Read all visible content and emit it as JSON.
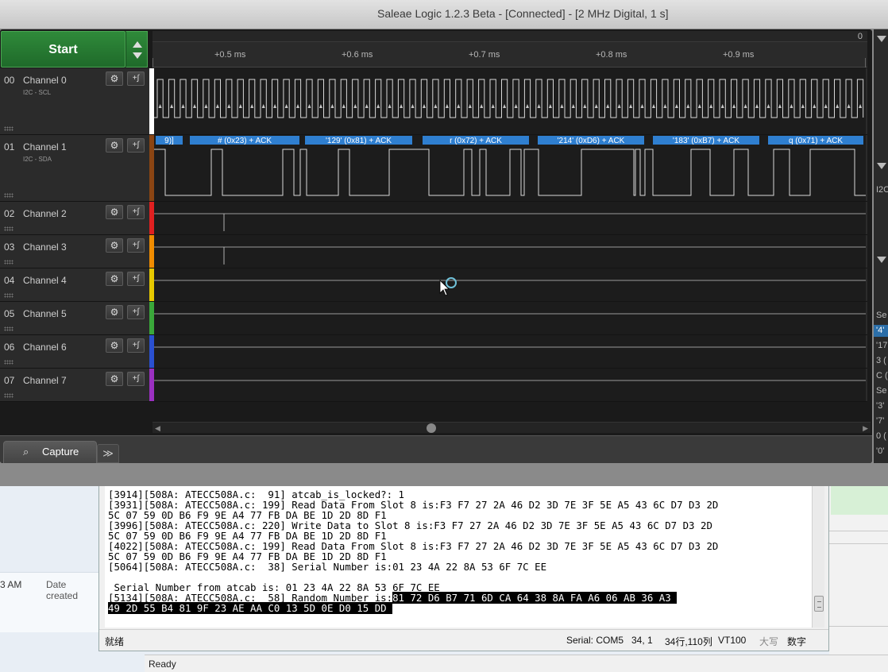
{
  "window": {
    "title": "Saleae Logic 1.2.3 Beta - [Connected] - [2 MHz Digital, 1 s]"
  },
  "toolbar": {
    "start_label": "Start"
  },
  "timeline": {
    "ticks": [
      "+0.5 ms",
      "+0.6 ms",
      "+0.7 ms",
      "+0.8 ms",
      "+0.9 ms"
    ],
    "corner_label": "0"
  },
  "channels": [
    {
      "num": "00",
      "name": "Channel 0",
      "sub": "I2C - SCL",
      "color": "#ffffff"
    },
    {
      "num": "01",
      "name": "Channel 1",
      "sub": "I2C - SDA",
      "color": "#8b4513"
    },
    {
      "num": "02",
      "name": "Channel 2",
      "sub": "",
      "color": "#e02020"
    },
    {
      "num": "03",
      "name": "Channel 3",
      "sub": "",
      "color": "#f08c00"
    },
    {
      "num": "04",
      "name": "Channel 4",
      "sub": "",
      "color": "#e6c800"
    },
    {
      "num": "05",
      "name": "Channel 5",
      "sub": "",
      "color": "#3aa83a"
    },
    {
      "num": "06",
      "name": "Channel 6",
      "sub": "",
      "color": "#2a50d0"
    },
    {
      "num": "07",
      "name": "Channel 7",
      "sub": "",
      "color": "#9a30c0"
    }
  ],
  "decoder_labels": [
    "9)]",
    "# (0x23) + ACK",
    "'129' (0x81) + ACK",
    "r (0x72) + ACK",
    "'214' (0xD6) + ACK",
    "'183' (0xB7) + ACK",
    "q (0x71) + ACK"
  ],
  "tabs": {
    "capture_label": "Capture",
    "more_label": "≫"
  },
  "right_panel": {
    "items": [
      "I2C",
      "Se",
      "'4'",
      "'17",
      "3 (",
      "C (",
      "Se",
      "'3'",
      "'7'",
      "0 (",
      "'0'"
    ]
  },
  "terminal": {
    "lines": [
      {
        "text": "[3914][508A: ATECC508A.c:  91] atcab_is_locked?: 1"
      },
      {
        "text": "[3931][508A: ATECC508A.c: 199] Read Data From Slot 8 is:F3 F7 27 2A 46 D2 3D 7E 3F 5E A5 43 6C D7 D3 2D"
      },
      {
        "text": "5C 07 59 0D B6 F9 9E A4 77 FB DA BE 1D 2D 8D F1"
      },
      {
        "text": "[3996][508A: ATECC508A.c: 220] Write Data to Slot 8 is:F3 F7 27 2A 46 D2 3D 7E 3F 5E A5 43 6C D7 D3 2D"
      },
      {
        "text": "5C 07 59 0D B6 F9 9E A4 77 FB DA BE 1D 2D 8D F1"
      },
      {
        "text": "[4022][508A: ATECC508A.c: 199] Read Data From Slot 8 is:F3 F7 27 2A 46 D2 3D 7E 3F 5E A5 43 6C D7 D3 2D"
      },
      {
        "text": "5C 07 59 0D B6 F9 9E A4 77 FB DA BE 1D 2D 8D F1"
      },
      {
        "text": "[5064][508A: ATECC508A.c:  38] Serial Number is:01 23 4A 22 8A 53 6F 7C EE"
      },
      {
        "text": ""
      },
      {
        "text": " Serial Number from atcab is: 01 23 4A 22 8A 53 6F 7C EE"
      },
      {
        "text": "[5134][508A: ATECC508A.c:  58] Random Number is:",
        "highlight": "81 72 D6 B7 71 6D CA 64 38 8A FA A6 06 AB 36 A3 "
      },
      {
        "text": "",
        "highlight": "49 2D 55 B4 81 9F 23 AE AA C0 13 5D 0E D0 15 DD "
      }
    ],
    "status": {
      "left": "就绪",
      "port": "Serial: COM5",
      "pos": "34,  1",
      "rowcol": "34行,110列",
      "mode": "VT100",
      "caps": "大写",
      "num": "数字"
    }
  },
  "explorer": {
    "time_fragment": "3 AM",
    "date_created": "Date created"
  },
  "statusbar": {
    "ready": "Ready"
  }
}
